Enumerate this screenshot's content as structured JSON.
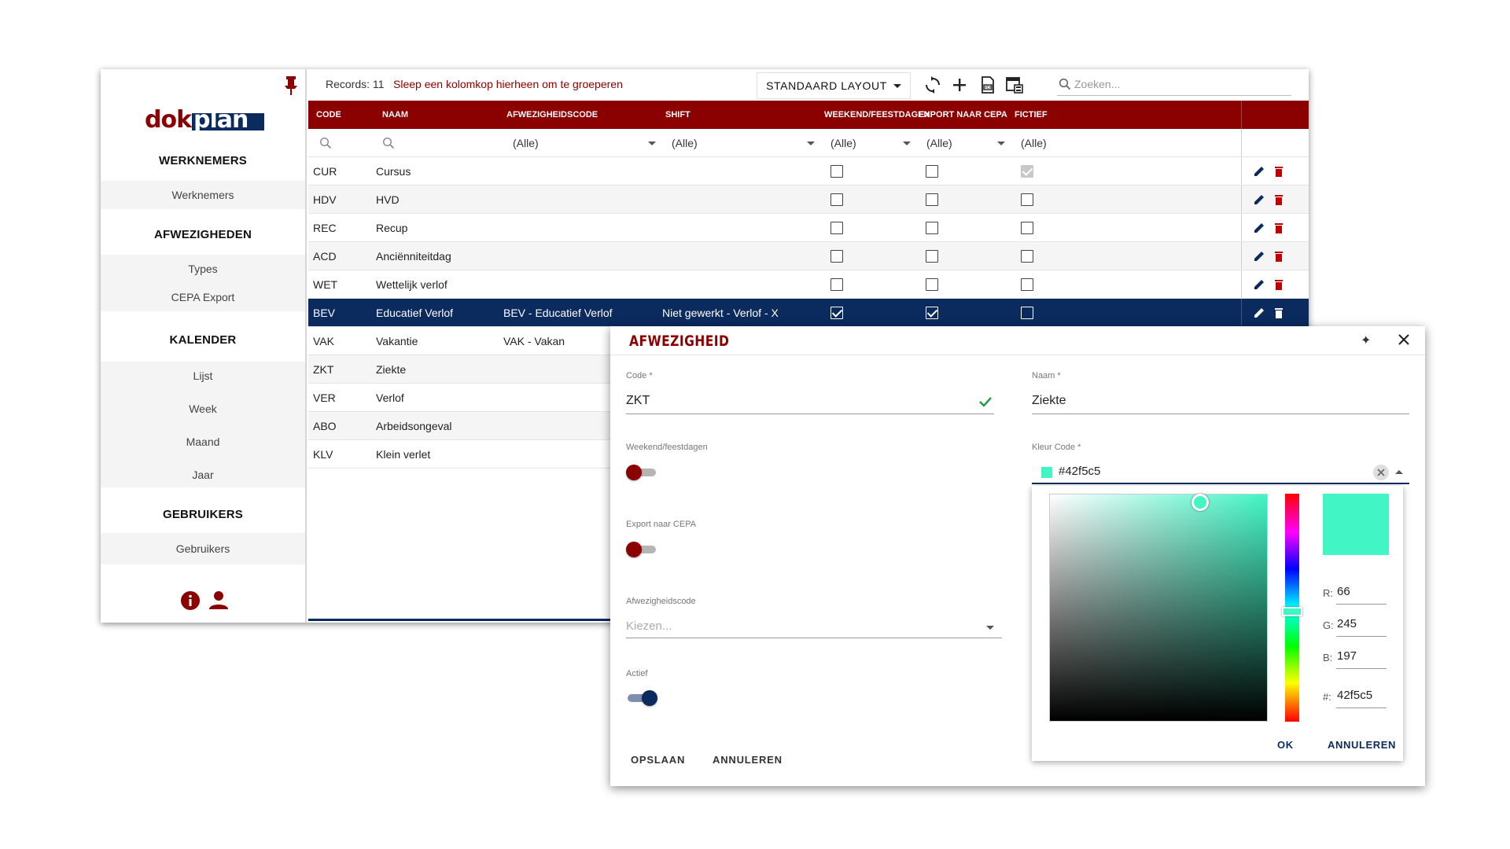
{
  "sidebar": {
    "logo_text": "dokplan",
    "sections": [
      {
        "title": "WERKNEMERS",
        "items": [
          "Werknemers"
        ]
      },
      {
        "title": "AFWEZIGHEDEN",
        "items": [
          "Types",
          "CEPA Export"
        ]
      },
      {
        "title": "KALENDER",
        "items": [
          "Lijst",
          "Week",
          "Maand",
          "Jaar"
        ]
      },
      {
        "title": "GEBRUIKERS",
        "items": [
          "Gebruikers"
        ]
      }
    ]
  },
  "toolbar": {
    "records_label": "Records: 11",
    "group_hint": "Sleep een kolomkop hierheen om te groeperen",
    "layout_button": "STANDAARD LAYOUT",
    "search_placeholder": "Zoeken..."
  },
  "grid": {
    "columns": [
      "CODE",
      "NAAM",
      "AFWEZIGHEIDSCODE",
      "SHIFT",
      "WEEKEND/FEESTDAGEN",
      "EXPORT NAAR CEPA",
      "FICTIEF"
    ],
    "filter_all": "(Alle)",
    "rows": [
      {
        "code": "CUR",
        "naam": "Cursus",
        "afwezigheidscode": "",
        "shift": "",
        "weekend": false,
        "cepa": false,
        "fictief": true
      },
      {
        "code": "HDV",
        "naam": "HVD",
        "afwezigheidscode": "",
        "shift": "",
        "weekend": false,
        "cepa": false,
        "fictief": false
      },
      {
        "code": "REC",
        "naam": "Recup",
        "afwezigheidscode": "",
        "shift": "",
        "weekend": false,
        "cepa": false,
        "fictief": false
      },
      {
        "code": "ACD",
        "naam": "Anciënniteitdag",
        "afwezigheidscode": "",
        "shift": "",
        "weekend": false,
        "cepa": false,
        "fictief": false
      },
      {
        "code": "WET",
        "naam": "Wettelijk verlof",
        "afwezigheidscode": "",
        "shift": "",
        "weekend": false,
        "cepa": false,
        "fictief": false
      },
      {
        "code": "BEV",
        "naam": "Educatief Verlof",
        "afwezigheidscode": "BEV - Educatief Verlof",
        "shift": "Niet gewerkt - Verlof - X",
        "weekend": true,
        "cepa": true,
        "fictief": false,
        "selected": true
      },
      {
        "code": "VAK",
        "naam": "Vakantie",
        "afwezigheidscode": "VAK - Vakan"
      },
      {
        "code": "ZKT",
        "naam": "Ziekte",
        "afwezigheidscode": ""
      },
      {
        "code": "VER",
        "naam": "Verlof",
        "afwezigheidscode": ""
      },
      {
        "code": "ABO",
        "naam": "Arbeidsongeval",
        "afwezigheidscode": ""
      },
      {
        "code": "KLV",
        "naam": "Klein verlet",
        "afwezigheidscode": ""
      }
    ]
  },
  "dialog": {
    "title": "AFWEZIGHEID",
    "code_label": "Code *",
    "code_value": "ZKT",
    "naam_label": "Naam *",
    "naam_value": "Ziekte",
    "weekend_label": "Weekend/feestdagen",
    "cepa_label": "Export naar CEPA",
    "afwcode_label": "Afwezigheidscode",
    "afwcode_placeholder": "Kiezen...",
    "actief_label": "Actief",
    "kleur_label": "Kleur Code *",
    "kleur_value": "#42f5c5",
    "save_button": "OPSLAAN",
    "cancel_button": "ANNULEREN",
    "weekend_on": false,
    "cepa_on": false,
    "actief_on": true
  },
  "color_picker": {
    "r_label": "R:",
    "r_value": "66",
    "g_label": "G:",
    "g_value": "245",
    "b_label": "B:",
    "b_value": "197",
    "hex_label": "#:",
    "hex_value": "42f5c5",
    "ok_button": "OK",
    "cancel_button": "ANNULEREN"
  },
  "colors": {
    "brand_red": "#8b0000",
    "navy": "#0b2a5e",
    "selected_color": "#42f5c5"
  }
}
